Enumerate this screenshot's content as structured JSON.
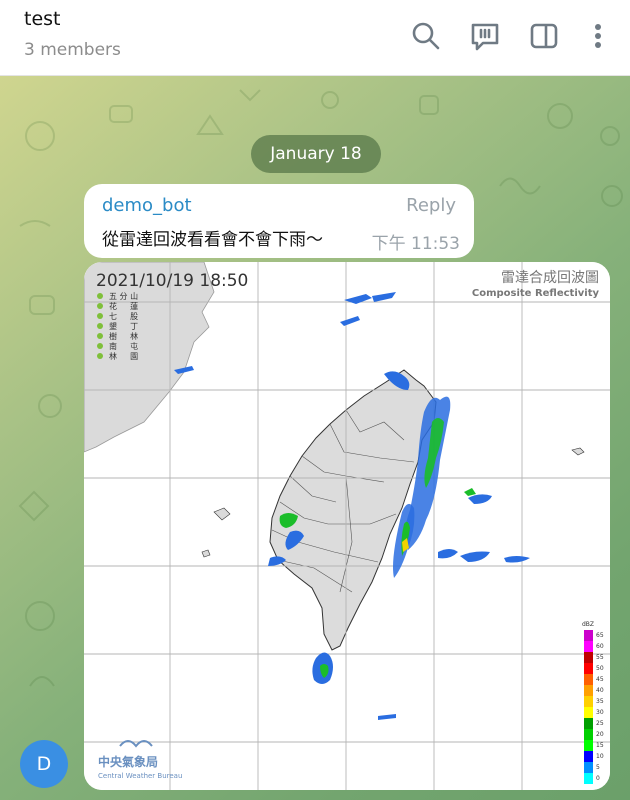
{
  "header": {
    "title": "test",
    "subtitle": "3 members",
    "icons": [
      "search-icon",
      "feedback-icon",
      "sidebar-icon",
      "more-vert-icon"
    ]
  },
  "chat": {
    "date_label": "January 18",
    "message": {
      "sender": "demo_bot",
      "reply_label": "Reply",
      "text": "從雷達回波看看會不會下雨～",
      "time": "下午 11:53"
    },
    "radar_image": {
      "timestamp": "2021/10/19   18:50",
      "title_zh": "雷達合成回波圖",
      "title_en": "Composite Reflectivity",
      "stations": [
        "五 分 山",
        "花 　 蓮",
        "七 　 股",
        "墾 　 丁",
        "樹 　 林",
        "南 　 屯",
        "林 　 園"
      ],
      "logo_zh": "中央氣象局",
      "logo_en": "Central Weather Bureau",
      "legend_unit": "dBZ",
      "legend_values": [
        "65",
        "60",
        "55",
        "50",
        "45",
        "40",
        "35",
        "30",
        "25",
        "20",
        "15",
        "10",
        "5",
        "0"
      ],
      "legend_colors": [
        "#cc00cc",
        "#ff00ff",
        "#c00000",
        "#ff0000",
        "#ff6000",
        "#ffa000",
        "#ffd000",
        "#ffff00",
        "#00a000",
        "#00d000",
        "#00ff00",
        "#0000ff",
        "#0090ff",
        "#00ffff"
      ]
    },
    "avatar_letter": "D"
  },
  "colors": {
    "accent": "#2b8bc6",
    "avatar": "#3a8fe3",
    "date_pill": "#547446"
  }
}
